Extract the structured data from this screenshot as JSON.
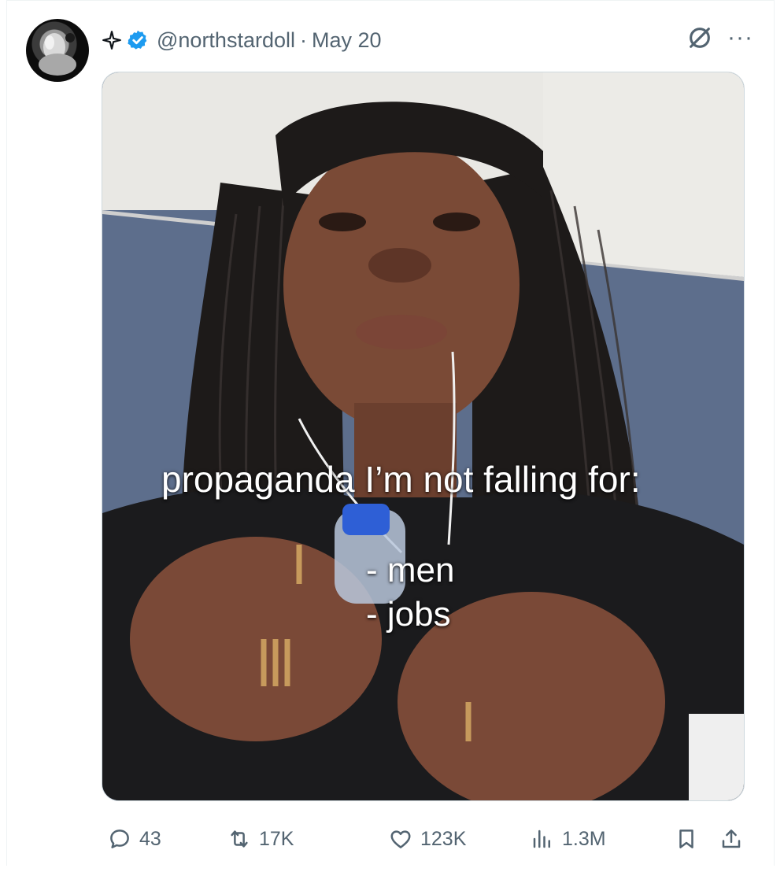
{
  "post": {
    "author_handle": "@northstardoll",
    "separator": "·",
    "date": "May 20",
    "icons": {
      "sparkle": "sparkle-icon",
      "verified": "verified-badge-icon",
      "grok": "grok-icon",
      "more": "more-icon"
    },
    "more_label": "···",
    "media": {
      "caption_line": "propaganda I’m not falling for:",
      "list": [
        "- men",
        "- jobs"
      ]
    }
  },
  "actions": {
    "reply": {
      "icon": "reply-icon",
      "count": "43"
    },
    "repost": {
      "icon": "repost-icon",
      "count": "17K"
    },
    "like": {
      "icon": "heart-icon",
      "count": "123K"
    },
    "views": {
      "icon": "views-icon",
      "count": "1.3M"
    },
    "bookmark": {
      "icon": "bookmark-icon"
    },
    "share": {
      "icon": "share-icon"
    }
  },
  "colors": {
    "text_secondary": "#536471",
    "verified_blue": "#1d9bf0",
    "border": "#cfd9de"
  }
}
